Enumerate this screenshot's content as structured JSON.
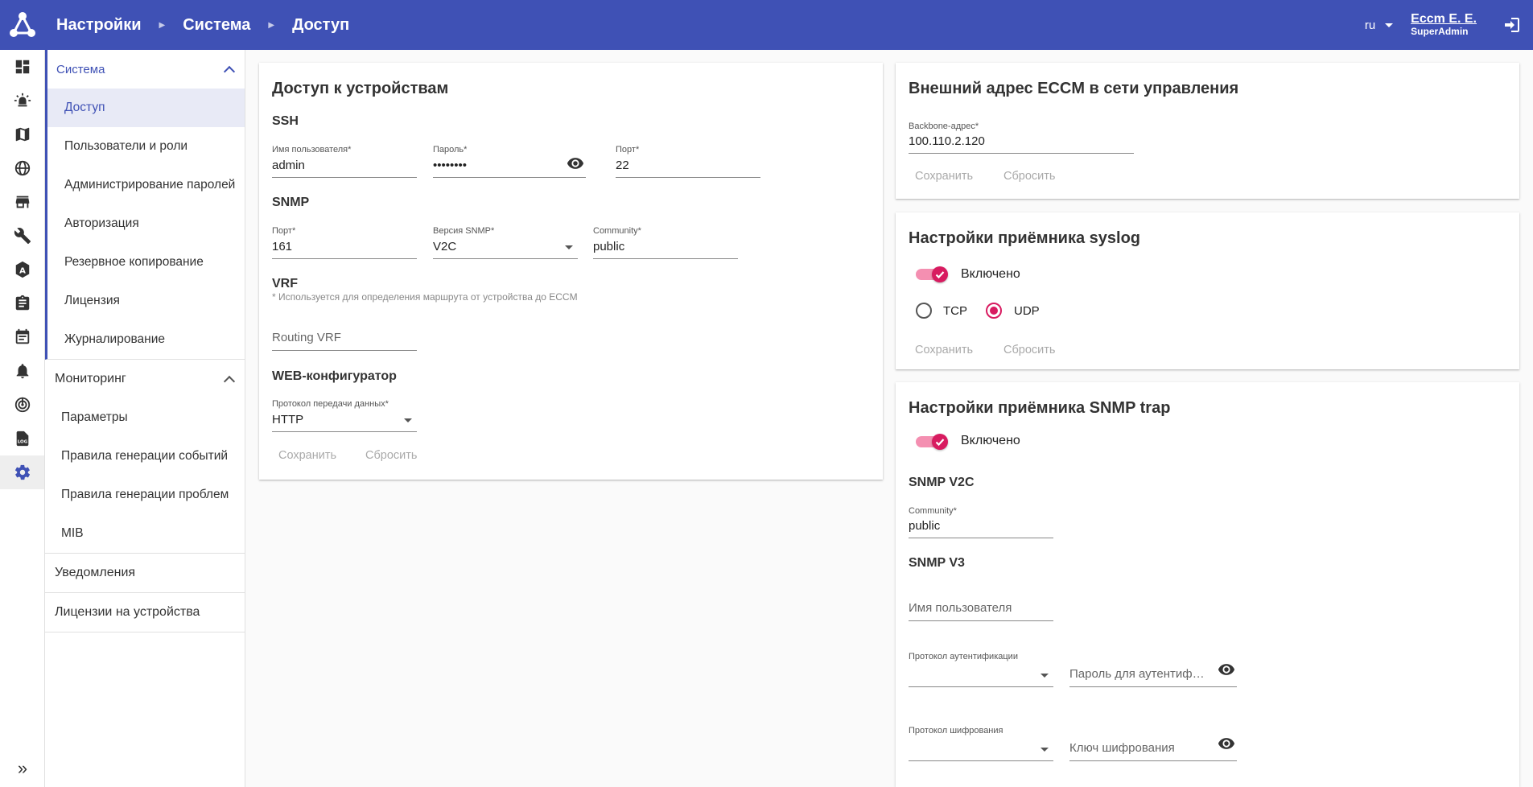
{
  "header": {
    "breadcrumbs": [
      "Настройки",
      "Система",
      "Доступ"
    ],
    "lang": "ru",
    "user_name": "Eccm E. E.",
    "user_role": "SuperAdmin"
  },
  "rail_icons": [
    "dashboard-icon",
    "alarm-icon",
    "map-icon",
    "globe-icon",
    "store-icon",
    "wrench-icon",
    "auto-icon",
    "clipboard-icon",
    "calendar-icon",
    "bell-icon",
    "radar-icon",
    "log-icon",
    "gear-icon"
  ],
  "sidebar": {
    "groups": [
      {
        "label": "Система",
        "expanded": true,
        "items": [
          "Доступ",
          "Пользователи и роли",
          "Администрирование паролей",
          "Авторизация",
          "Резервное копирование",
          "Лицензия",
          "Журналирование"
        ]
      },
      {
        "label": "Мониторинг",
        "expanded": true,
        "items": [
          "Параметры",
          "Правила генерации событий",
          "Правила генерации проблем",
          "MIB"
        ]
      },
      {
        "label": "Уведомления",
        "expanded": false,
        "items": []
      },
      {
        "label": "Лицензии на устройства",
        "expanded": false,
        "items": []
      }
    ],
    "active_item": "Доступ"
  },
  "access_card": {
    "title": "Доступ к устройствам",
    "ssh": {
      "title": "SSH",
      "username_label": "Имя пользователя*",
      "username": "admin",
      "password_label": "Пароль*",
      "password": "••••••••",
      "port_label": "Порт*",
      "port": "22"
    },
    "snmp": {
      "title": "SNMP",
      "port_label": "Порт*",
      "port": "161",
      "version_label": "Версия SNMP*",
      "version": "V2C",
      "community_label": "Community*",
      "community": "public"
    },
    "vrf": {
      "title": "VRF",
      "hint": "* Используется для определения маршрута от устройства до ECCM",
      "placeholder": "Routing VRF"
    },
    "web": {
      "title": "WEB-конфигуратор",
      "protocol_label": "Протокол передачи данных*",
      "protocol": "HTTP"
    },
    "save": "Сохранить",
    "reset": "Сбросить"
  },
  "external_card": {
    "title": "Внешний адрес ECCM в сети управления",
    "backbone_label": "Backbone-адрес*",
    "backbone": "100.110.2.120",
    "save": "Сохранить",
    "reset": "Сбросить"
  },
  "syslog_card": {
    "title": "Настройки приёмника syslog",
    "enabled_label": "Включено",
    "enabled": true,
    "tcp": "TCP",
    "udp": "UDP",
    "selected": "UDP",
    "save": "Сохранить",
    "reset": "Сбросить"
  },
  "trap_card": {
    "title": "Настройки приёмника SNMP trap",
    "enabled_label": "Включено",
    "enabled": true,
    "v2c_title": "SNMP V2C",
    "community_label": "Community*",
    "community": "public",
    "v3_title": "SNMP V3",
    "username_placeholder": "Имя пользователя",
    "auth_protocol_label": "Протокол аутентификации",
    "auth_password_placeholder": "Пароль для аутентифика...",
    "priv_protocol_label": "Протокол шифрования",
    "priv_key_placeholder": "Ключ шифрования"
  },
  "colors": {
    "primary": "#3f51b5",
    "accent": "#d81b60",
    "disabled_text": "#aaaaaa"
  }
}
